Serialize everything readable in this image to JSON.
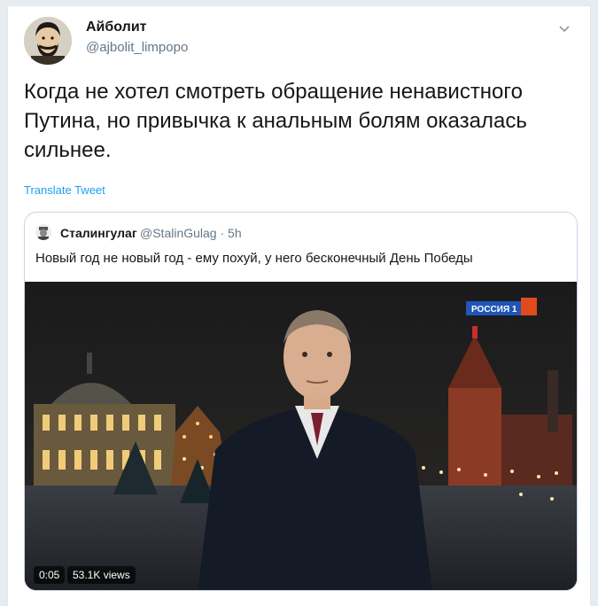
{
  "author": {
    "name": "Айболит",
    "handle": "@ajbolit_limpopo",
    "avatar_icon": "avatar-portrait-icon"
  },
  "menu_icon": "chevron-down-icon",
  "tweet": {
    "text": "Когда не хотел смотреть обращение ненавистного Путина, но привычка к анальным болям оказалась сильнее.",
    "translate_label": "Translate Tweet"
  },
  "quoted": {
    "name": "Сталингулаг",
    "handle": "@StalinGulag · 5h",
    "text": "Новый год не новый год - ему похуй, у него бесконечный День Победы"
  },
  "video": {
    "channel_logo": "РОССИЯ 1",
    "duration": "0:05",
    "views": "53.1K views"
  },
  "colors": {
    "link": "#1da1f2",
    "secondary_text": "#657786",
    "border": "#ccd6dd"
  }
}
